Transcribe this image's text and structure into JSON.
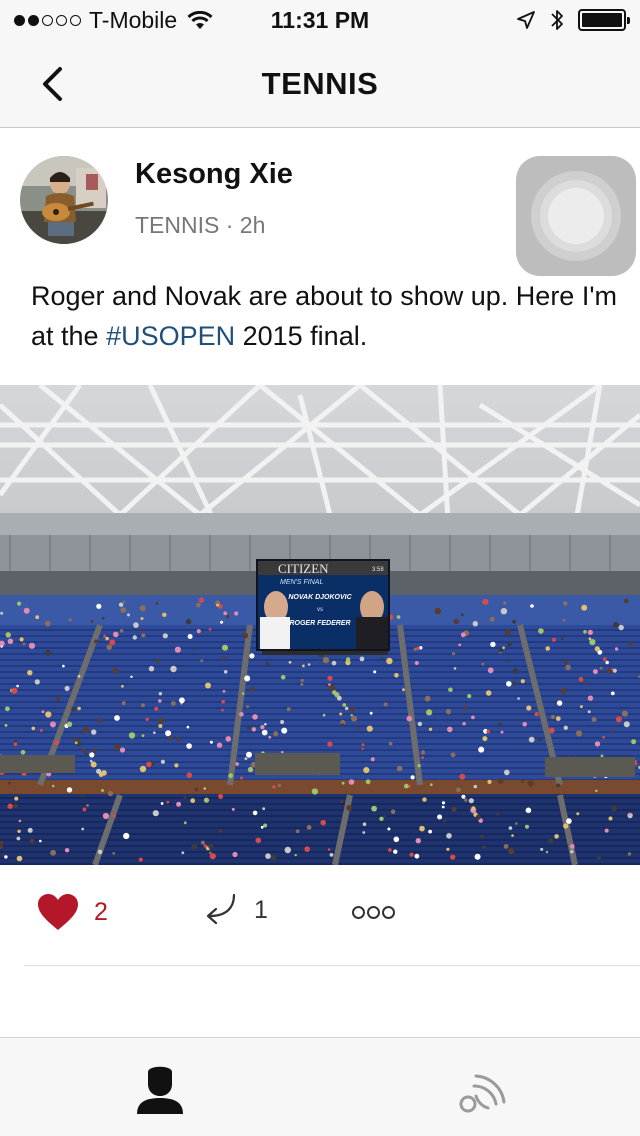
{
  "status_bar": {
    "carrier": "T-Mobile",
    "time": "11:31 PM",
    "signal_bars": 2,
    "battery_level": 1.0
  },
  "nav": {
    "title": "TENNIS",
    "back_icon": "chevron-left-icon"
  },
  "post": {
    "author": "Kesong Xie",
    "channel": "TENNIS",
    "separator": " · ",
    "age": "2h",
    "text_before": "Roger and Novak are about to show up. Here I'm at the ",
    "hashtag": "#USOPEN",
    "text_after": " 2015 final.",
    "scoreboard": {
      "sponsor": "CITIZEN",
      "clock": "3:58",
      "event": "MEN'S FINAL",
      "player1": "NOVAK DJOKOVIC",
      "vs": "vs",
      "player2": "ROGER FEDERER"
    }
  },
  "actions": {
    "likes": "2",
    "replies": "1",
    "like_icon": "heart-icon",
    "reply_icon": "reply-arrow-icon",
    "more_icon": "more-icon"
  },
  "tab_bar": {
    "tabs": [
      {
        "icon": "person-icon",
        "active": true
      },
      {
        "icon": "feed-icon",
        "active": false
      }
    ]
  },
  "colors": {
    "like": "#b5172a",
    "hashtag": "#1f4f7a",
    "bar_bg": "#f7f7f7"
  }
}
